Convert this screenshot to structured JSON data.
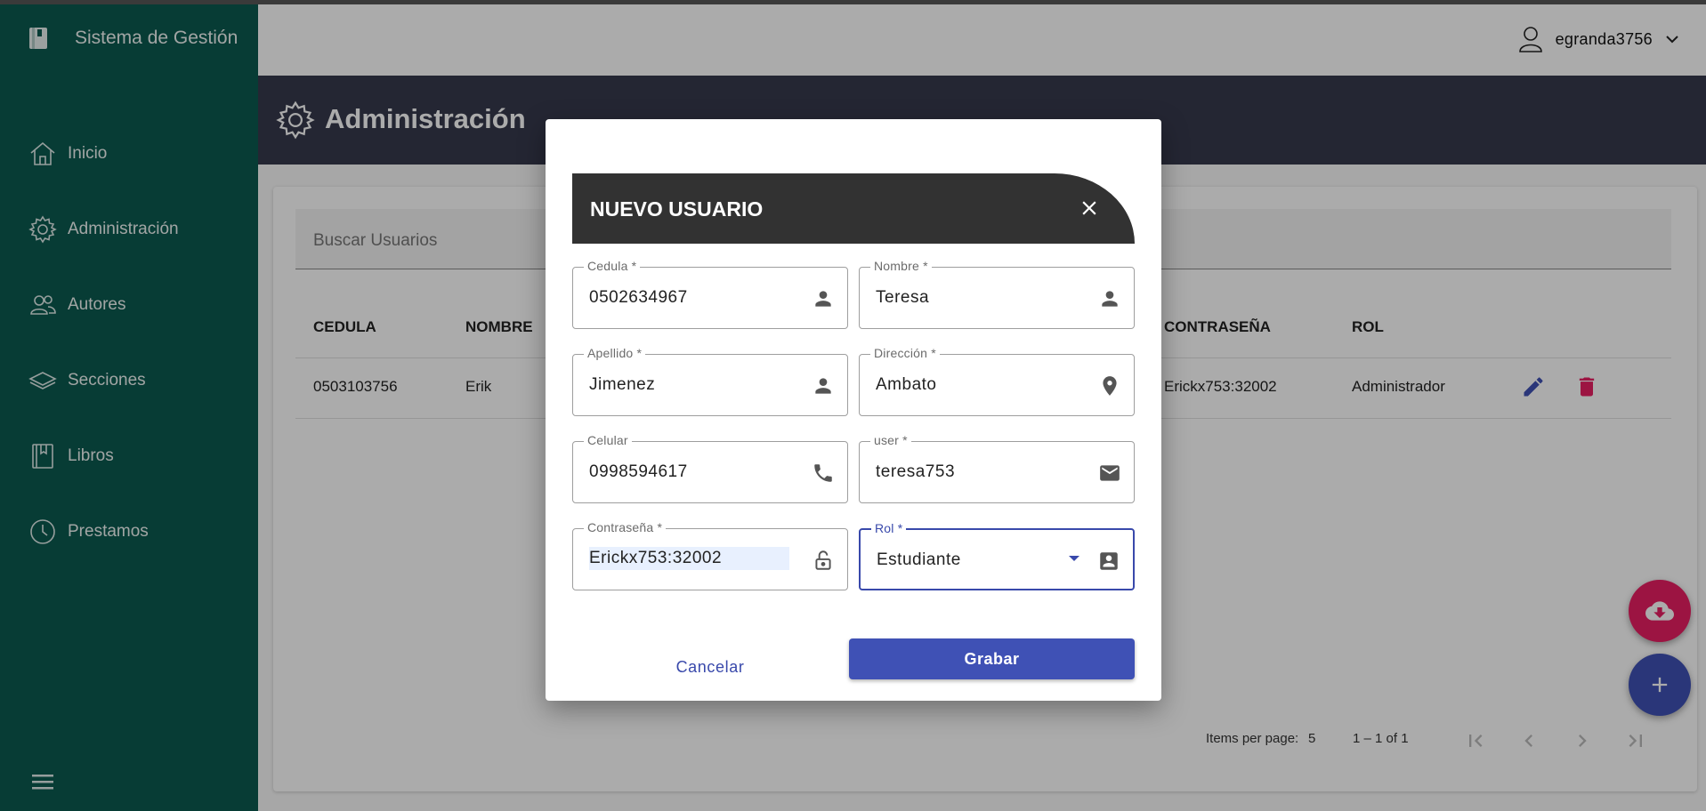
{
  "app": {
    "title": "Sistema de Gestión"
  },
  "sidebar": {
    "items": [
      {
        "label": "Inicio",
        "icon": "home-icon"
      },
      {
        "label": "Administración",
        "icon": "gear-icon"
      },
      {
        "label": "Autores",
        "icon": "people-icon"
      },
      {
        "label": "Secciones",
        "icon": "layers-icon"
      },
      {
        "label": "Libros",
        "icon": "book-icon"
      },
      {
        "label": "Prestamos",
        "icon": "clock-icon"
      }
    ]
  },
  "topbar": {
    "username": "egranda3756"
  },
  "header": {
    "title": "Administración"
  },
  "search": {
    "placeholder": "Buscar Usuarios"
  },
  "table": {
    "columns": [
      "CEDULA",
      "NOMBRE",
      "CONTRASEÑA",
      "ROL"
    ],
    "rows": [
      {
        "cedula": "0503103756",
        "nombre": "Erik",
        "contrasena": "Erickx753:32002",
        "rol": "Administrador"
      }
    ]
  },
  "paginator": {
    "items_per_page_label": "Items per page:",
    "items_per_page": "5",
    "range": "1 – 1 of 1"
  },
  "dialog": {
    "title": "NUEVO USUARIO",
    "fields": {
      "cedula": {
        "label": "Cedula *",
        "value": "0502634967"
      },
      "nombre": {
        "label": "Nombre *",
        "value": "Teresa"
      },
      "apellido": {
        "label": "Apellido *",
        "value": "Jimenez"
      },
      "direccion": {
        "label": "Dirección *",
        "value": "Ambato"
      },
      "celular": {
        "label": "Celular",
        "value": "0998594617"
      },
      "user": {
        "label": "user *",
        "value": "teresa753"
      },
      "contrasena": {
        "label": "Contraseña *",
        "value": "Erickx753:32002"
      },
      "rol": {
        "label": "Rol *",
        "value": "Estudiante"
      }
    },
    "cancel_label": "Cancelar",
    "save_label": "Grabar"
  },
  "colors": {
    "sidebar": "#0b5a4f",
    "header": "#373a4d",
    "primary": "#3f51b5",
    "accent": "#e91e63"
  }
}
